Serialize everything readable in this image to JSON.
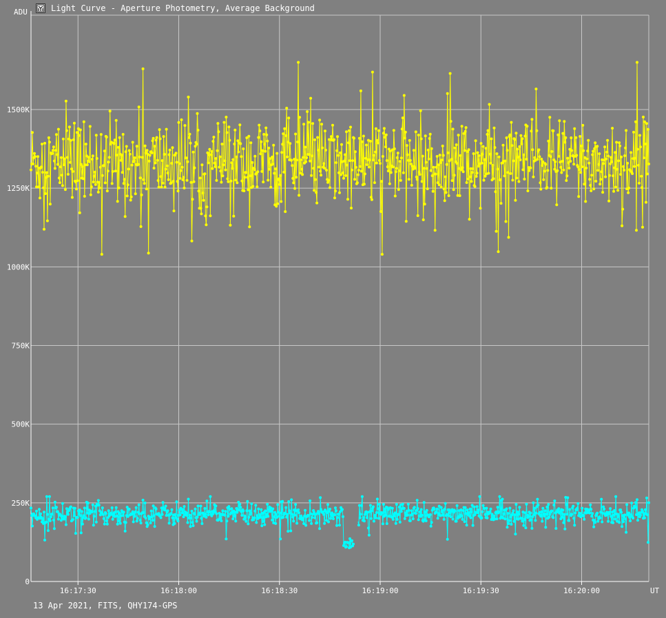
{
  "window": {
    "title": "Light Curve - Aperture Photometry, Average Background",
    "icon": "light-curve-app-icon"
  },
  "footer": {
    "caption": "13 Apr 2021, FITS, QHY174-GPS"
  },
  "colors": {
    "background": "#808080",
    "grid": "#c8c8c8",
    "axis": "#ffffff",
    "target": "#ffff00",
    "comparison": "#00ffff"
  },
  "chart_data": {
    "type": "line",
    "title": "Light Curve - Aperture Photometry, Average Background",
    "ylabel": "ADU",
    "xlabel": "UT",
    "grid": true,
    "ylim": [
      0,
      1800000
    ],
    "y_ticks": [
      {
        "value": 0,
        "label": "0"
      },
      {
        "value": 250000,
        "label": "250K"
      },
      {
        "value": 500000,
        "label": "500K"
      },
      {
        "value": 750000,
        "label": "750K"
      },
      {
        "value": 1000000,
        "label": "1000K"
      },
      {
        "value": 1250000,
        "label": "1250K"
      },
      {
        "value": 1500000,
        "label": "1500K"
      }
    ],
    "x_ticks": [
      {
        "label": "16:17:30"
      },
      {
        "label": "16:18:00"
      },
      {
        "label": "16:18:30"
      },
      {
        "label": "16:19:00"
      },
      {
        "label": "16:19:30"
      },
      {
        "label": "16:20:00"
      }
    ],
    "x_range": [
      "16:17:16",
      "16:20:20"
    ],
    "series": [
      {
        "color": "#ffff00",
        "mean": 1330000,
        "scatter": 70000,
        "min": 1040000,
        "max": 1650000,
        "dip": null
      },
      {
        "color": "#00ffff",
        "mean": 215000,
        "scatter": 18000,
        "min": 110000,
        "max": 270000,
        "dip": {
          "start": "16:18:49",
          "end": "16:18:52",
          "value": 120000
        }
      }
    ]
  }
}
